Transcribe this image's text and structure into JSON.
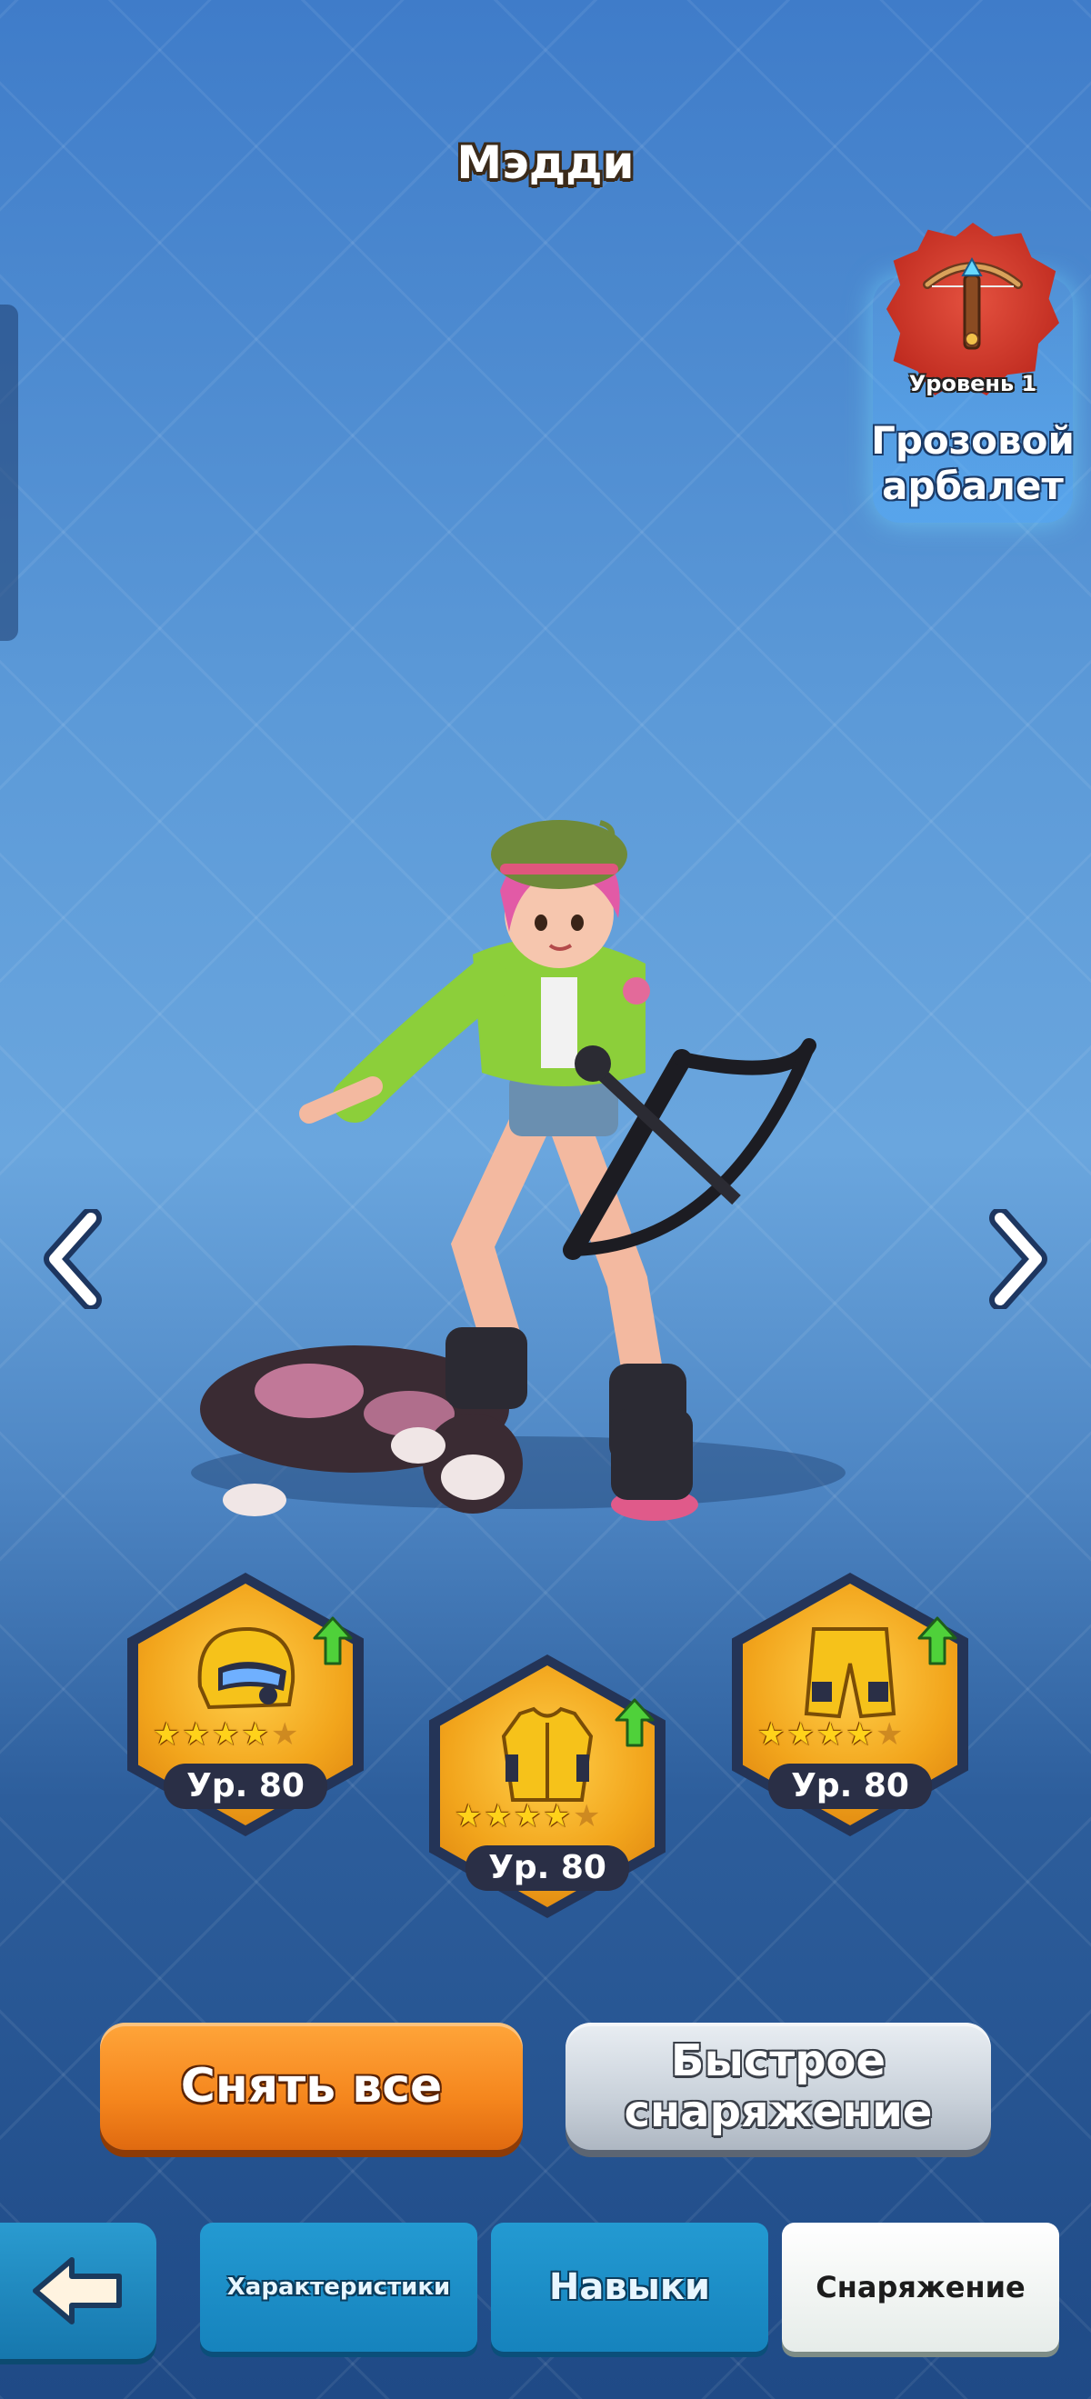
{
  "hero": {
    "name": "Мэдди"
  },
  "weapon": {
    "level_label": "Уровень 1",
    "name_line1": "Грозовой",
    "name_line2": "арбалет",
    "badge_color": "#c9302a"
  },
  "navigation": {
    "prev_icon": "chevron-left-icon",
    "next_icon": "chevron-right-icon"
  },
  "gear": [
    {
      "slot": "helmet",
      "level": "Ур. 80",
      "stars": 4,
      "max_stars": 5,
      "upgrade_available": true
    },
    {
      "slot": "armor",
      "level": "Ур. 80",
      "stars": 4,
      "max_stars": 5,
      "upgrade_available": true
    },
    {
      "slot": "pants",
      "level": "Ур. 80",
      "stars": 4,
      "max_stars": 5,
      "upgrade_available": true
    }
  ],
  "actions": {
    "remove_all": "Снять все",
    "quick_gear_line1": "Быстрое",
    "quick_gear_line2": "снаряжение"
  },
  "tabs": [
    {
      "label": "Характеристики",
      "active": false
    },
    {
      "label": "Навыки",
      "active": false
    },
    {
      "label": "Снаряжение",
      "active": true
    }
  ],
  "colors": {
    "accent_orange": "#f5861d",
    "tab_blue": "#1e8ec9",
    "gear_gold": "#f2a51c"
  }
}
